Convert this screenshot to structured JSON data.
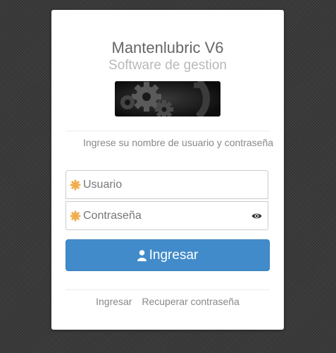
{
  "app": {
    "title": "Mantenlubric V6",
    "subtitle": "Software de gestion"
  },
  "logo": {
    "icon": "gears-icon",
    "background_color": "#111111"
  },
  "login": {
    "instructions": "Ingrese su nombre de usuario y contraseña",
    "username_placeholder": "Usuario",
    "username_value": "",
    "password_placeholder": "Contraseña",
    "password_value": "",
    "field_icon": "asterisk-icon",
    "field_icon_color": "#f0ad4e",
    "show_password_icon": "eye-icon",
    "submit_label": "Ingresar",
    "submit_icon": "user-icon",
    "submit_color": "#428bca"
  },
  "footer": {
    "link_login": "Ingresar",
    "link_recover": "Recuperar contraseña"
  }
}
